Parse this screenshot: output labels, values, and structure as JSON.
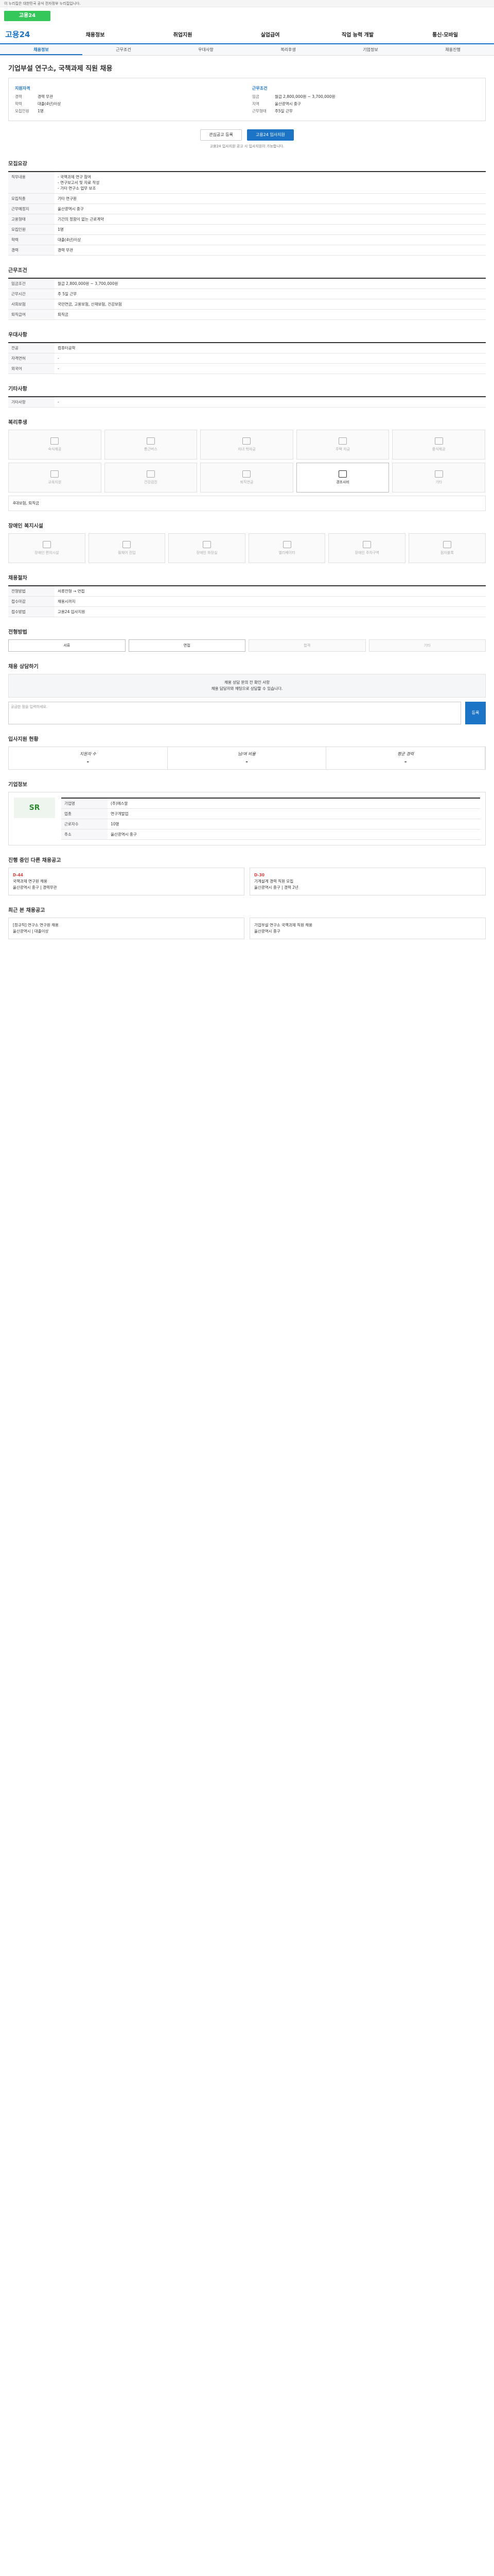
{
  "gov": "이 누리집은 대한민국 공식 전자정부 누리집입니다.",
  "header": {
    "site": "고용24",
    "nav": [
      "채용정보",
      "취업지원",
      "실업급여",
      "직업 능력 개발",
      "통신·모바일"
    ]
  },
  "tabs": [
    "채용정보",
    "근무조건",
    "우대사항",
    "복리후생",
    "기업정보",
    "채용진행"
  ],
  "job": {
    "title": "기업부설 연구소, 국책과제 직원 채용",
    "h1": "지원자격",
    "h2": "근무조건",
    "left": [
      [
        "경력",
        "경력 무관"
      ],
      [
        "학력",
        "대졸(4년)이상"
      ],
      [
        "모집인원",
        "1명"
      ]
    ],
    "right": [
      [
        "임금",
        "월급 2,800,000원 ~ 3,700,000원"
      ],
      [
        "지역",
        "울산광역시 중구"
      ],
      [
        "근무형태",
        "주5일 근무"
      ]
    ],
    "btn_save": "관심공고 등록",
    "btn_apply": "고용24 입사지원",
    "note": "고용24 입사지원 공고 시 입사지원이 가능합니다."
  },
  "sec": {
    "recruit": "모집요강",
    "conditions": "근무조건",
    "pref": "우대사항",
    "other": "기타사항",
    "welfare": "복리후생",
    "disabled": "장애인 복지시설",
    "process": "채용절차",
    "progress": "전형방법",
    "docs": "제출서류",
    "qa": "채용 상담하기",
    "stats": "입사지원 현황",
    "company": "기업정보",
    "ongoing": "진행 중인 다른 채용공고",
    "recent": "최근 본 채용공고"
  },
  "recruit": [
    [
      "직무내용",
      "- 국책과제 연구 참여\n- 연구보고서 및 자료 작성\n- 기타 연구소 업무 보조"
    ],
    [
      "모집직종",
      "기타 연구원"
    ],
    [
      "근무예정지",
      "울산광역시 중구"
    ],
    [
      "고용형태",
      "기간의 정함이 없는 근로계약"
    ],
    [
      "모집인원",
      "1명"
    ],
    [
      "학력",
      "대졸(4년)이상"
    ],
    [
      "경력",
      "경력 무관"
    ]
  ],
  "conditions": [
    [
      "임금조건",
      "월급 2,800,000원 ~ 3,700,000원"
    ],
    [
      "근무시간",
      "주 5일 근무"
    ],
    [
      "사회보험",
      "국민연금, 고용보험, 산재보험, 건강보험"
    ],
    [
      "퇴직급여",
      "퇴직금"
    ]
  ],
  "pref": [
    [
      "전공",
      "컴퓨터공학"
    ],
    [
      "자격면허",
      "-"
    ],
    [
      "외국어",
      "-"
    ]
  ],
  "other": [
    [
      "기타사항",
      "-"
    ]
  ],
  "welfare_items": [
    "숙식제공",
    "통근버스",
    "자녀 학자금",
    "주택 자금",
    "중식제공",
    "교육지원",
    "건강검진",
    "퇴직연금",
    "경조사비",
    "기타"
  ],
  "welfare_text": "4대보험, 퇴직금",
  "disabled_items": [
    "장애인 편의시설",
    "휠체어 진입",
    "장애인 화장실",
    "엘리베이터",
    "장애인 주차구역",
    "점자블록"
  ],
  "process": [
    [
      "전형방법",
      "서류전형 → 면접"
    ],
    [
      "접수마감",
      "채용시까지"
    ],
    [
      "접수방법",
      "고용24 입사지원"
    ]
  ],
  "progress_items": [
    "서류",
    "면접",
    "합격",
    "기타"
  ],
  "qa_text": "채용 상담 문의 전 확인 사항\n채용 담당자와 채팅으로 상담할 수 있습니다.",
  "qa_ph": "궁금한 점을 입력하세요.",
  "qa_btn": "등록",
  "stats": [
    [
      "지원자 수",
      "-"
    ],
    [
      "남/여 비율",
      "-"
    ],
    [
      "평균 경력",
      "-"
    ]
  ],
  "company": {
    "logo": "SR",
    "rows": [
      [
        "기업명",
        "(주)에스알"
      ],
      [
        "업종",
        "연구개발업"
      ],
      [
        "근로자수",
        "10명"
      ],
      [
        "주소",
        "울산광역시 중구"
      ]
    ]
  },
  "ongoing": [
    {
      "d": "D-44",
      "t": "국책과제 연구원 채용",
      "s": "울산광역시 중구 | 경력무관"
    },
    {
      "d": "D-30",
      "t": "기계설계 경력 직원 모집",
      "s": "울산광역시 중구 | 경력 2년"
    }
  ],
  "recent": [
    {
      "t": "[정규직] 연구소 연구원 채용",
      "s": "울산광역시 | 대졸이상"
    },
    {
      "t": "기업부설 연구소 국책과제 직원 채용",
      "s": "울산광역시 중구"
    }
  ]
}
